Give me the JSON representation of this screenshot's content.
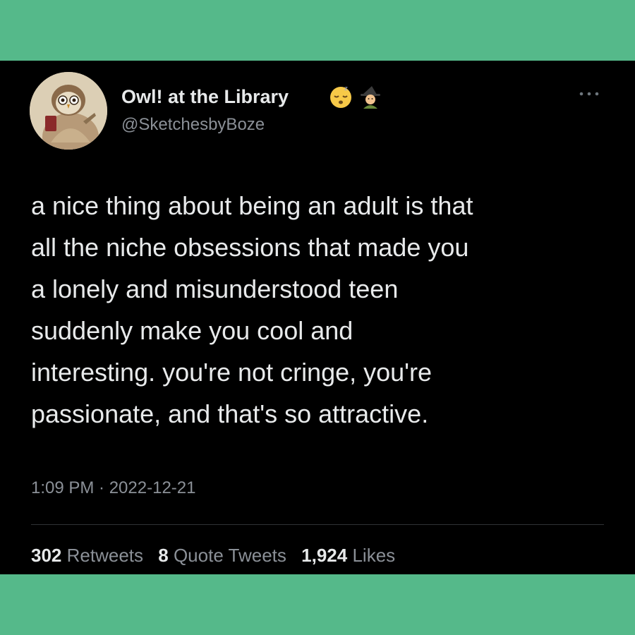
{
  "tweet": {
    "author": {
      "display_name": "Owl! at the Library",
      "handle": "@SketchesbyBoze",
      "name_emojis": [
        "sleeping-face",
        "witch"
      ]
    },
    "text_lines": [
      "a nice thing about being an adult is that",
      "all the niche obsessions that made you",
      "a lonely and misunderstood teen",
      "suddenly make you cool and",
      "interesting. you're not cringe, you're",
      "passionate, and that's so attractive."
    ],
    "timestamp": "1:09 PM · 2022-12-21",
    "stats": {
      "retweets_count": "302",
      "retweets_label": "Retweets",
      "quotes_count": "8",
      "quotes_label": "Quote Tweets",
      "likes_count": "1,924",
      "likes_label": "Likes"
    },
    "icons": [
      "avatar-owl",
      "more-options-icon"
    ]
  },
  "colors": {
    "frame": "#55b98a",
    "card": "#000000",
    "primary_text": "#e7e9ea",
    "secondary_text": "#8b9097",
    "divider": "#2f3336"
  }
}
